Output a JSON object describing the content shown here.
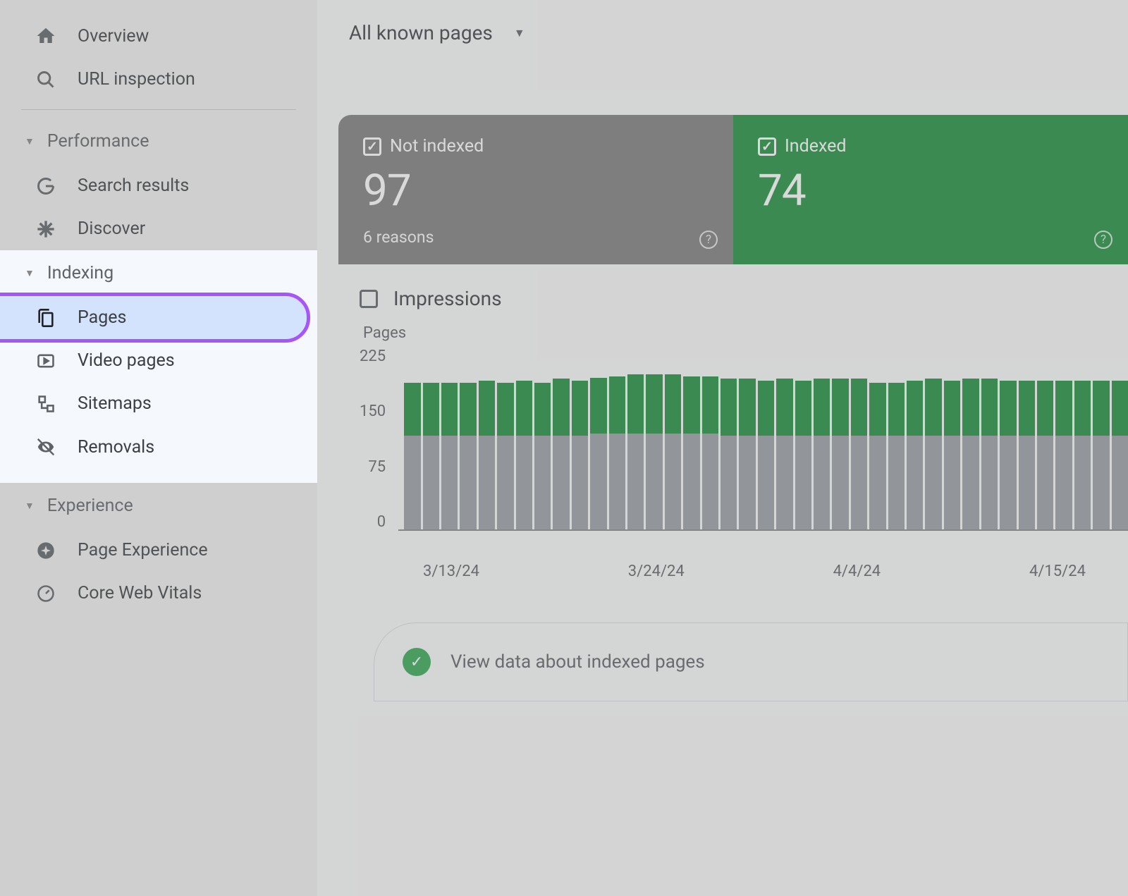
{
  "sidebar": {
    "overview": "Overview",
    "url_inspection": "URL inspection",
    "section_performance": "Performance",
    "search_results": "Search results",
    "discover": "Discover",
    "section_indexing": "Indexing",
    "pages": "Pages",
    "video_pages": "Video pages",
    "sitemaps": "Sitemaps",
    "removals": "Removals",
    "section_experience": "Experience",
    "page_experience": "Page Experience",
    "core_web_vitals": "Core Web Vitals"
  },
  "filter": {
    "label": "All known pages"
  },
  "stats": {
    "not_indexed": {
      "label": "Not indexed",
      "value": "97",
      "subtext": "6 reasons"
    },
    "indexed": {
      "label": "Indexed",
      "value": "74"
    }
  },
  "impressions_label": "Impressions",
  "chart_data": {
    "type": "bar",
    "title": "Pages",
    "ylabel": "Pages",
    "ylim": [
      0,
      225
    ],
    "yticks": [
      0,
      75,
      150,
      225
    ],
    "xticks": [
      "3/13/24",
      "3/24/24",
      "4/4/24",
      "4/15/24"
    ],
    "categories": [
      "3/13",
      "3/14",
      "3/15",
      "3/16",
      "3/17",
      "3/18",
      "3/19",
      "3/20",
      "3/21",
      "3/22",
      "3/23",
      "3/24",
      "3/25",
      "3/26",
      "3/27",
      "3/28",
      "3/29",
      "3/30",
      "3/31",
      "4/1",
      "4/2",
      "4/3",
      "4/4",
      "4/5",
      "4/6",
      "4/7",
      "4/8",
      "4/9",
      "4/10",
      "4/11",
      "4/12",
      "4/13",
      "4/14",
      "4/15",
      "4/16",
      "4/17",
      "4/18",
      "4/19",
      "4/20"
    ],
    "series": [
      {
        "name": "Not indexed",
        "color": "#9aa0a6",
        "values": [
          115,
          115,
          115,
          115,
          115,
          115,
          115,
          115,
          115,
          115,
          118,
          118,
          118,
          118,
          118,
          118,
          118,
          115,
          115,
          115,
          115,
          115,
          115,
          115,
          115,
          115,
          115,
          115,
          115,
          115,
          115,
          115,
          115,
          115,
          115,
          115,
          115,
          115,
          115
        ]
      },
      {
        "name": "Indexed",
        "color": "#1e8e3e",
        "values": [
          65,
          65,
          65,
          65,
          68,
          65,
          68,
          65,
          70,
          68,
          68,
          70,
          72,
          72,
          72,
          70,
          70,
          70,
          70,
          68,
          70,
          68,
          70,
          70,
          70,
          65,
          65,
          68,
          70,
          68,
          70,
          70,
          68,
          68,
          68,
          68,
          68,
          68,
          68
        ]
      }
    ]
  },
  "view_data_text": "View data about indexed pages"
}
